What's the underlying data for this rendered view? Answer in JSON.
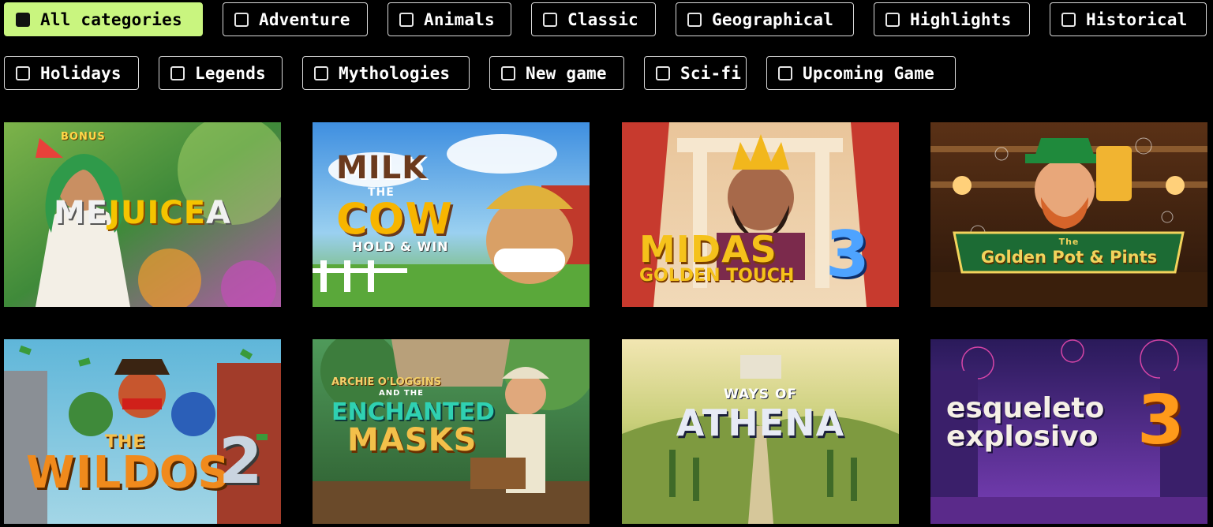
{
  "filters": [
    {
      "label": "All categories",
      "checked": true
    },
    {
      "label": "Adventure",
      "checked": false
    },
    {
      "label": "Animals",
      "checked": false
    },
    {
      "label": "Classic",
      "checked": false
    },
    {
      "label": "Geographical",
      "checked": false
    },
    {
      "label": "Highlights",
      "checked": false
    },
    {
      "label": "Historical",
      "checked": false
    },
    {
      "label": "Holidays",
      "checked": false
    },
    {
      "label": "Legends",
      "checked": false
    },
    {
      "label": "Mythologies",
      "checked": false
    },
    {
      "label": "New game",
      "checked": false
    },
    {
      "label": "Sci-fi",
      "checked": false
    },
    {
      "label": "Upcoming Game",
      "checked": false
    }
  ],
  "games": [
    {
      "title_a": "ME",
      "title_b": "JUICE",
      "title_c": "A",
      "badge": "BONUS",
      "accent": "#f5c400"
    },
    {
      "title_a": "MILK",
      "title_b": "THE",
      "title_c": "COW",
      "subtitle": "HOLD & WIN",
      "accent": "#f7b500"
    },
    {
      "title_a": "MIDAS",
      "title_b": "GOLDEN TOUCH",
      "title_c": "3",
      "accent": "#f5c21b"
    },
    {
      "title_a": "The",
      "title_b": "Golden Pot & Pints",
      "accent": "#f2d35c"
    },
    {
      "title_a": "THE",
      "title_b": "WILDOS",
      "title_c": "2",
      "accent": "#f08a1c"
    },
    {
      "title_a": "ARCHIE O'LOGGINS",
      "title_b": "AND THE",
      "title_c": "ENCHANTED",
      "title_d": "MASKS",
      "accent": "#2fd1b2"
    },
    {
      "title_a": "WAYS OF",
      "title_b": "ATHENA",
      "accent": "#d8dcea"
    },
    {
      "title_a": "esqueleto",
      "title_b": "explosivo",
      "title_c": "3",
      "accent": "#ff9a1a"
    }
  ]
}
